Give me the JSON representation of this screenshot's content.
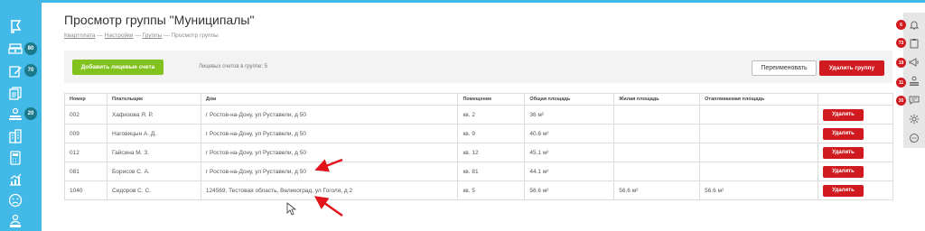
{
  "page": {
    "title": "Просмотр группы \"Муниципалы\"",
    "breadcrumb": [
      "Квартплата",
      "Настройки",
      "Группы",
      "Просмотр группы"
    ],
    "separator": "—"
  },
  "sidebar": {
    "items": [
      {
        "icon": "flag-icon"
      },
      {
        "icon": "money-stack-icon",
        "badge": "80"
      },
      {
        "icon": "edit-icon",
        "badge": "70"
      },
      {
        "icon": "documents-icon"
      },
      {
        "icon": "hand-coins-icon",
        "badge": "20"
      },
      {
        "icon": "building-icon"
      },
      {
        "icon": "calculator-icon"
      },
      {
        "icon": "chart-growth-icon"
      },
      {
        "icon": "sad-face-icon"
      },
      {
        "icon": "person-desk-icon"
      }
    ]
  },
  "toolbar": {
    "add_accounts": "Добавить лицевые счета",
    "accounts_info": "Лицевых счетов в группе: 5",
    "rename": "Переименовать",
    "delete_group": "Удалить группу"
  },
  "table": {
    "columns": [
      "Номер",
      "Плательщик",
      "Дом",
      "Помещение",
      "Общая площадь",
      "Жилая площадь",
      "Отапливаемая площадь",
      ""
    ],
    "delete_label": "Удалить",
    "rows": [
      {
        "number": "002",
        "payer": "Хафизова Я. Р.",
        "house": "г Ростов-на-Дону, ул Руставели, д 50",
        "room": "кв. 2",
        "total_area": "36 м²",
        "living_area": "",
        "heated_area": ""
      },
      {
        "number": "009",
        "payer": "Наговицын А. Д.",
        "house": "г Ростов-на-Дону, ул Руставели, д 50",
        "room": "кв. 9",
        "total_area": "40.6 м²",
        "living_area": "",
        "heated_area": ""
      },
      {
        "number": "012",
        "payer": "Гайсина М. З.",
        "house": "г Ростов-на-Дону, ул Руставели, д 50",
        "room": "кв. 12",
        "total_area": "45.1 м²",
        "living_area": "",
        "heated_area": ""
      },
      {
        "number": "081",
        "payer": "Борисов С. А.",
        "house": "г Ростов-на-Дону, ул Руставели, д 50",
        "room": "кв. 81",
        "total_area": "44.1 м²",
        "living_area": "",
        "heated_area": ""
      },
      {
        "number": "1040",
        "payer": "Сидоров С. С.",
        "house": "124569, Тестовая область, Великоград, ул Гоголя, д 2",
        "room": "кв. 5",
        "total_area": "56.6 м²",
        "living_area": "56.6 м²",
        "heated_area": "56.6 м²"
      }
    ]
  },
  "right_panel": {
    "items": [
      {
        "icon": "bell-icon",
        "badge": "6"
      },
      {
        "icon": "clipboard-icon",
        "badge": "73"
      },
      {
        "icon": "megaphone-icon",
        "badge": "19"
      },
      {
        "icon": "hand-coins-icon",
        "badge": "11"
      },
      {
        "icon": "chat-icon",
        "badge": "30"
      },
      {
        "icon": "gear-icon"
      },
      {
        "icon": "support-chat-icon"
      }
    ]
  },
  "colors": {
    "sidebar": "#43b9e8",
    "badge_dark": "#1a7a8c",
    "primary_red": "#d11a1f",
    "primary_green": "#82c21f",
    "annotation_arrow": "#e0141a"
  }
}
